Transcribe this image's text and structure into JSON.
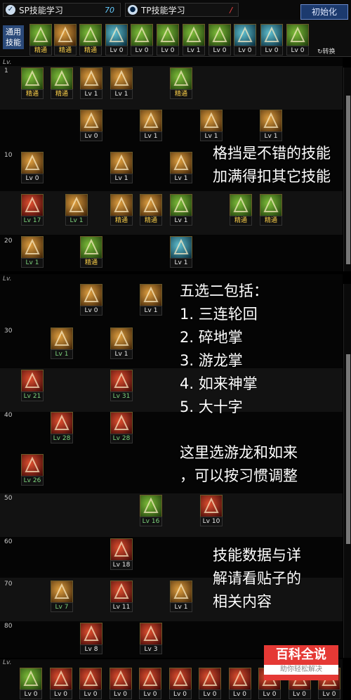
{
  "tabs": [
    {
      "label": "SP技能学习",
      "value": "70"
    },
    {
      "label": "TP技能学习",
      "value": "/"
    }
  ],
  "init_button": "初始化",
  "generic_label": "通用\n技能",
  "switch_label": "转换",
  "section_header": "Lv.",
  "level_marks": [
    "1",
    "10",
    "20",
    "30",
    "40",
    "50",
    "60",
    "70",
    "80"
  ],
  "generic_skills": [
    {
      "lv": "精通",
      "t": "green"
    },
    {
      "lv": "精通",
      "t": "gold"
    },
    {
      "lv": "精通",
      "t": "green"
    },
    {
      "lv": "Lv 0",
      "t": "blue"
    },
    {
      "lv": "Lv 0",
      "t": "green"
    },
    {
      "lv": "Lv 0",
      "t": "green"
    },
    {
      "lv": "Lv 1",
      "t": "green"
    },
    {
      "lv": "Lv 0",
      "t": "green"
    },
    {
      "lv": "Lv 0",
      "t": "blue"
    },
    {
      "lv": "Lv 0",
      "t": "blue"
    },
    {
      "lv": "Lv 0",
      "t": "green"
    }
  ],
  "tree1": [
    {
      "lv": "精通",
      "t": "green",
      "c": "gold"
    },
    {
      "lv": "精通",
      "t": "green",
      "c": "gold"
    },
    {
      "lv": "Lv 1",
      "t": "gold",
      "c": "white"
    },
    {
      "lv": "Lv 1",
      "t": "gold",
      "c": "white"
    },
    {
      "lv": "精通",
      "t": "green",
      "c": "gold"
    },
    {
      "lv": "Lv 0",
      "t": "gold",
      "c": "white"
    },
    {
      "lv": "Lv 1",
      "t": "gold",
      "c": "white"
    },
    {
      "lv": "Lv 1",
      "t": "gold",
      "c": "white"
    },
    {
      "lv": "Lv 1",
      "t": "gold",
      "c": "white"
    },
    {
      "lv": "Lv 0",
      "t": "gold",
      "c": "white"
    },
    {
      "lv": "Lv 1",
      "t": "gold",
      "c": "white"
    },
    {
      "lv": "Lv 1",
      "t": "gold",
      "c": "white"
    },
    {
      "lv": "Lv 17",
      "t": "red",
      "c": "green"
    },
    {
      "lv": "Lv 1",
      "t": "gold",
      "c": "green"
    },
    {
      "lv": "精通",
      "t": "gold",
      "c": "gold"
    },
    {
      "lv": "精通",
      "t": "gold",
      "c": "gold"
    },
    {
      "lv": "Lv 1",
      "t": "green",
      "c": "white"
    },
    {
      "lv": "精通",
      "t": "green",
      "c": "gold"
    },
    {
      "lv": "精通",
      "t": "green",
      "c": "gold"
    },
    {
      "lv": "Lv 1",
      "t": "gold",
      "c": "green"
    },
    {
      "lv": "精通",
      "t": "green",
      "c": "gold"
    },
    {
      "lv": "Lv 1",
      "t": "blue",
      "c": "white"
    }
  ],
  "tree2": [
    {
      "lv": "Lv 0",
      "t": "gold",
      "c": "white"
    },
    {
      "lv": "Lv 1",
      "t": "gold",
      "c": "white"
    },
    {
      "lv": "Lv 1",
      "t": "gold",
      "c": "green"
    },
    {
      "lv": "Lv 1",
      "t": "gold",
      "c": "white"
    },
    {
      "lv": "Lv 21",
      "t": "red",
      "c": "green"
    },
    {
      "lv": "Lv 31",
      "t": "red",
      "c": "green"
    },
    {
      "lv": "Lv 28",
      "t": "red",
      "c": "green"
    },
    {
      "lv": "Lv 28",
      "t": "red",
      "c": "green"
    },
    {
      "lv": "Lv 26",
      "t": "red",
      "c": "green"
    },
    {
      "lv": "Lv 16",
      "t": "green",
      "c": "green"
    },
    {
      "lv": "Lv 10",
      "t": "red",
      "c": "white"
    },
    {
      "lv": "Lv 18",
      "t": "red",
      "c": "white"
    },
    {
      "lv": "Lv 7",
      "t": "gold",
      "c": "green"
    },
    {
      "lv": "Lv 11",
      "t": "red",
      "c": "white"
    },
    {
      "lv": "Lv 1",
      "t": "gold",
      "c": "white"
    },
    {
      "lv": "Lv 8",
      "t": "red",
      "c": "white"
    },
    {
      "lv": "Lv 3",
      "t": "red",
      "c": "white"
    }
  ],
  "quickbar": [
    {
      "lv": "Lv 0",
      "t": "green"
    },
    {
      "lv": "Lv 0",
      "t": "red"
    },
    {
      "lv": "Lv 0",
      "t": "red"
    },
    {
      "lv": "Lv 0",
      "t": "red"
    },
    {
      "lv": "Lv 0",
      "t": "red"
    },
    {
      "lv": "Lv 0",
      "t": "red"
    },
    {
      "lv": "Lv 0",
      "t": "red"
    },
    {
      "lv": "Lv 0",
      "t": "red"
    },
    {
      "lv": "Lv 0",
      "t": "red"
    },
    {
      "lv": "Lv 0",
      "t": "red"
    },
    {
      "lv": "Lv 0",
      "t": "red"
    }
  ],
  "notes": {
    "n1": "格挡是不错的技能\n加满得扣其它技能",
    "n2": "五选二包括：\n1. 三连轮回\n2. 碎地掌\n3. 游龙掌\n4. 如来神掌\n5. 大十字",
    "n3": "这里选游龙和如来\n，可以按习惯调整",
    "n4": "技能数据与详\n解请看贴子的\n相关内容"
  },
  "watermark": {
    "big": "百科全说",
    "small": "助你轻松解决"
  }
}
